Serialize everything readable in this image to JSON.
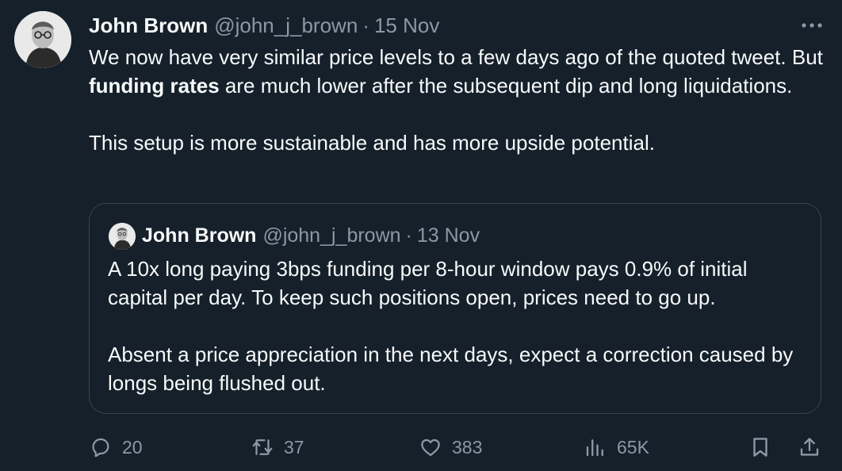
{
  "tweet": {
    "author": {
      "name": "John Brown",
      "handle": "@john_j_brown",
      "separator": "·",
      "date": "15 Nov",
      "avatar_icon": "avatar-portrait"
    },
    "more_icon": "more-dots-icon",
    "body": {
      "line1_before": "We now have very similar price levels to a few days ago of the quoted tweet. But ",
      "bold": "funding rates",
      "line1_after": " are much lower after the subsequent dip and long liquidations.",
      "paragraph2": "This setup is more sustainable and has more upside potential."
    },
    "quoted": {
      "author": {
        "name": "John Brown",
        "handle": "@john_j_brown",
        "separator": "·",
        "date": "13 Nov"
      },
      "paragraph1": "A 10x long paying 3bps funding per 8-hour window pays 0.9% of initial capital per day. To keep such positions open, prices need to go up.",
      "paragraph2": "Absent a price appreciation in the next days, expect a correction caused by longs being flushed out."
    },
    "actions": {
      "replies": "20",
      "retweets": "37",
      "likes": "383",
      "views": "65K"
    }
  },
  "colors": {
    "background": "#15202b",
    "text_primary": "#f7f9f9",
    "text_secondary": "#8b98a5",
    "border": "#38444d"
  }
}
